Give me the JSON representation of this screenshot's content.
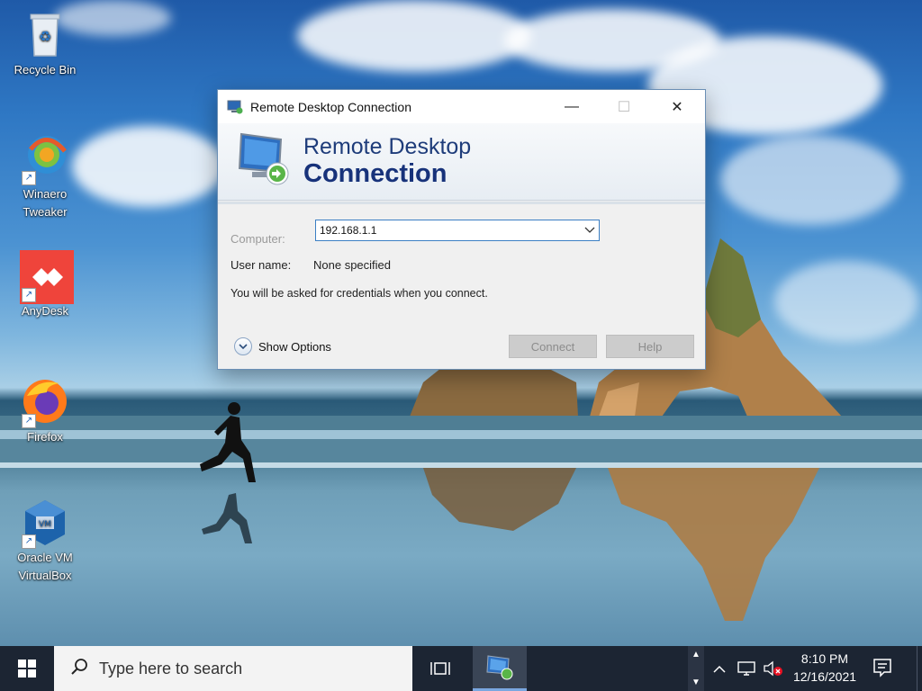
{
  "desktop": {
    "icons": [
      {
        "label": "Recycle Bin",
        "icon": "recycle-bin-icon"
      },
      {
        "label": "Winaero Tweaker",
        "icon": "winaero-tweaker-icon"
      },
      {
        "label": "AnyDesk",
        "icon": "anydesk-icon"
      },
      {
        "label": "Firefox",
        "icon": "firefox-icon"
      },
      {
        "label": "Oracle VM VirtualBox",
        "icon": "virtualbox-icon"
      }
    ]
  },
  "dialog": {
    "title": "Remote Desktop Connection",
    "banner_line1": "Remote Desktop",
    "banner_line2": "Connection",
    "computer_label": "Computer:",
    "computer_value": "192.168.1.1",
    "username_label": "User name:",
    "username_value": "None specified",
    "credentials_note": "You will be asked for credentials when you connect.",
    "show_options": "Show Options",
    "connect_label": "Connect",
    "help_label": "Help",
    "minimize_glyph": "—",
    "maximize_glyph": "☐",
    "close_glyph": "✕"
  },
  "taskbar": {
    "search_placeholder": "Type here to search",
    "time": "8:10 PM",
    "date": "12/16/2021"
  },
  "colors": {
    "taskbar_bg": "#1c2533",
    "banner_text": "#17327a",
    "combo_border": "#3c7fc4"
  }
}
